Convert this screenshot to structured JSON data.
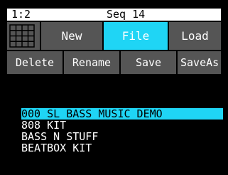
{
  "status": {
    "position": "1:2",
    "sequence": "Seq 14"
  },
  "tabs": {
    "new": "New",
    "file": "File",
    "load": "Load"
  },
  "actions": {
    "delete": "Delete",
    "rename": "Rename",
    "save": "Save",
    "save_as": "SaveAs"
  },
  "files": [
    {
      "name": "000 SL BASS MUSIC DEMO",
      "selected": true
    },
    {
      "name": "808 KIT",
      "selected": false
    },
    {
      "name": "BASS N STUFF",
      "selected": false
    },
    {
      "name": "BEATBOX KIT",
      "selected": false
    }
  ],
  "colors": {
    "accent": "#1fd5f5",
    "button": "#555555",
    "background": "#000000",
    "statusbar": "#ffffff"
  },
  "icons": {
    "grid": "grid-icon"
  }
}
